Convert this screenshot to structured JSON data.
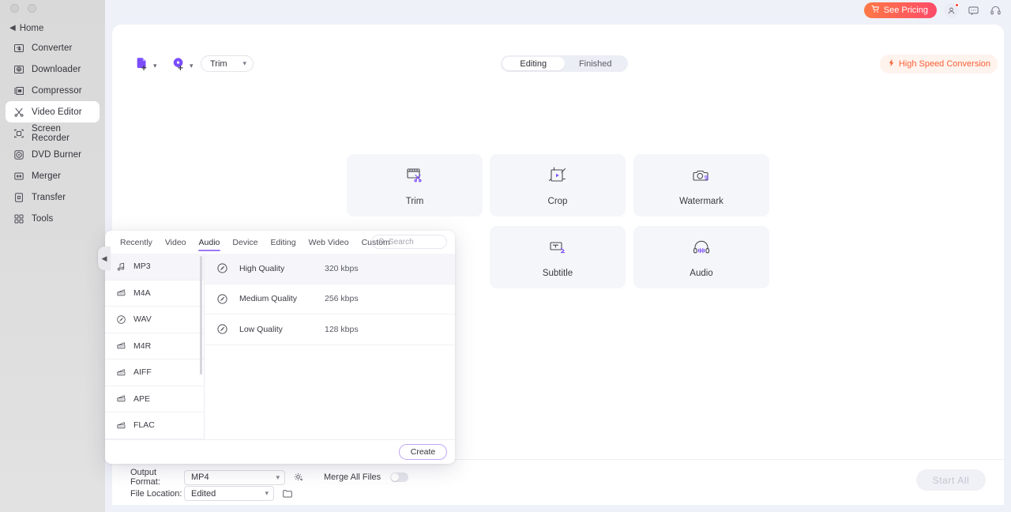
{
  "window": {
    "dots": 2
  },
  "sidebar": {
    "back_label": "Home",
    "items": [
      {
        "label": "Converter",
        "icon": "converter-icon",
        "active": false
      },
      {
        "label": "Downloader",
        "icon": "downloader-icon",
        "active": false
      },
      {
        "label": "Compressor",
        "icon": "compressor-icon",
        "active": false
      },
      {
        "label": "Video Editor",
        "icon": "video-editor-icon",
        "active": true
      },
      {
        "label": "Screen Recorder",
        "icon": "screen-recorder-icon",
        "active": false
      },
      {
        "label": "DVD Burner",
        "icon": "dvd-burner-icon",
        "active": false
      },
      {
        "label": "Merger",
        "icon": "merger-icon",
        "active": false
      },
      {
        "label": "Transfer",
        "icon": "transfer-icon",
        "active": false
      },
      {
        "label": "Tools",
        "icon": "tools-icon",
        "active": false
      }
    ]
  },
  "header": {
    "pricing_label": "See Pricing",
    "icons": [
      "account-icon",
      "feedback-icon",
      "support-icon"
    ]
  },
  "toolbar": {
    "add_file_icon": "add-file-icon",
    "add_disc_icon": "add-disc-icon",
    "mode_select": "Trim",
    "tabs": [
      {
        "label": "Editing",
        "active": true
      },
      {
        "label": "Finished",
        "active": false
      }
    ],
    "high_speed_label": "High Speed Conversion"
  },
  "tiles": [
    {
      "label": "Trim",
      "icon": "trim-icon"
    },
    {
      "label": "Crop",
      "icon": "crop-icon"
    },
    {
      "label": "Watermark",
      "icon": "watermark-icon"
    },
    {
      "label": "Subtitle",
      "icon": "subtitle-icon"
    },
    {
      "label": "Audio",
      "icon": "audio-icon"
    }
  ],
  "bottom": {
    "output_format_label": "Output Format:",
    "output_format_value": "MP4",
    "settings_icon": "gear-settings-icon",
    "merge_label": "Merge All Files",
    "merge_on": false,
    "file_location_label": "File Location:",
    "file_location_value": "Edited",
    "folder_icon": "folder-icon",
    "start_all_label": "Start  All"
  },
  "modal": {
    "tabs": [
      {
        "label": "Recently",
        "active": false
      },
      {
        "label": "Video",
        "active": false
      },
      {
        "label": "Audio",
        "active": true
      },
      {
        "label": "Device",
        "active": false
      },
      {
        "label": "Editing",
        "active": false
      },
      {
        "label": "Web Video",
        "active": false
      },
      {
        "label": "Custom",
        "active": false
      }
    ],
    "search_placeholder": "Search",
    "search_value": "",
    "formats": [
      {
        "label": "MP3",
        "active": true
      },
      {
        "label": "M4A",
        "active": false
      },
      {
        "label": "WAV",
        "active": false
      },
      {
        "label": "M4R",
        "active": false
      },
      {
        "label": "AIFF",
        "active": false
      },
      {
        "label": "APE",
        "active": false
      },
      {
        "label": "FLAC",
        "active": false
      }
    ],
    "qualities": [
      {
        "label": "High Quality",
        "bitrate": "320 kbps",
        "active": true
      },
      {
        "label": "Medium Quality",
        "bitrate": "256 kbps",
        "active": false
      },
      {
        "label": "Low Quality",
        "bitrate": "128 kbps",
        "active": false
      }
    ],
    "create_label": "Create"
  },
  "colors": {
    "accent_purple": "#7c4dff",
    "tab_underline": "#9b7cf5",
    "pricing_gradient_start": "#ff7a45",
    "pricing_gradient_end": "#fd4a6a",
    "high_speed_orange": "#fb6036"
  }
}
